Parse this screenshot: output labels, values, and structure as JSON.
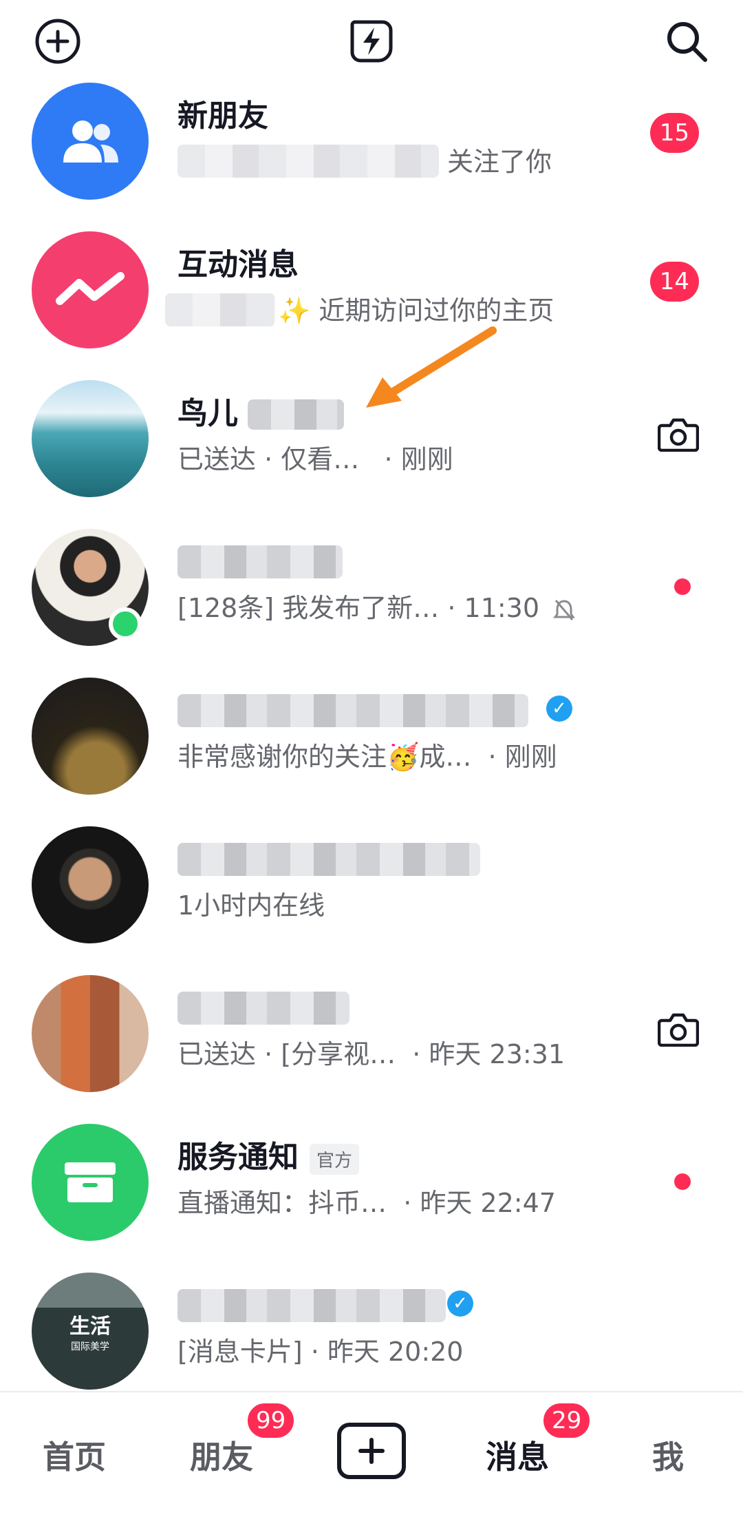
{
  "colors": {
    "accent": "#fe2c55",
    "online": "#2ad36d",
    "verify": "#20a0f0",
    "orange_arrow": "#f5871f"
  },
  "topbar": {
    "icons": [
      "plus-circle-icon",
      "flash-chat-icon",
      "search-icon"
    ]
  },
  "rows": [
    {
      "title": "新朋友",
      "sub_visible": "关注了你",
      "badge": "15"
    },
    {
      "title": "互动消息",
      "sub_visible": "✨ 近期访问过你的主页",
      "badge": "14"
    },
    {
      "title": "鸟儿",
      "sub": "已送达 · 仅看…",
      "time": "· 刚刚"
    },
    {
      "sub": "[128条] 我发布了新…",
      "time": "· 11:30"
    },
    {
      "sub": "非常感谢你的关注🥳成…",
      "time": "· 刚刚"
    },
    {
      "sub": "1小时内在线"
    },
    {
      "sub": "已送达 · [分享视…",
      "time": "· 昨天 23:31"
    },
    {
      "title": "服务通知",
      "tag": "官方",
      "sub": "直播通知：抖币…",
      "time": "· 昨天 22:47"
    },
    {
      "sub": "[消息卡片] · 昨天 20:20",
      "avatar_text": "生活",
      "avatar_small": "国际美学"
    }
  ],
  "nav": {
    "home": "首页",
    "friends": "朋友",
    "friends_badge": "99",
    "messages": "消息",
    "messages_badge": "29",
    "me": "我"
  }
}
